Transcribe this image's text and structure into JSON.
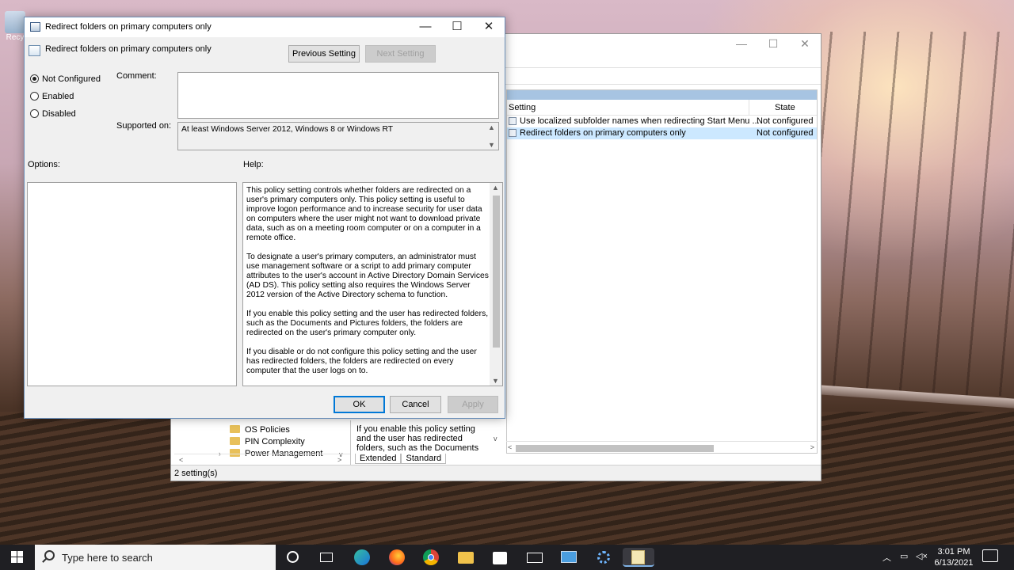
{
  "desktop": {
    "recycle_label": "Recy"
  },
  "background_window": {
    "columns": {
      "setting": "Setting",
      "state": "State"
    },
    "rows": [
      {
        "name": "Use localized subfolder names when redirecting Start Menu ...",
        "state": "Not configured"
      },
      {
        "name": "Redirect folders on primary computers only",
        "state": "Not configured"
      }
    ],
    "tree_items": [
      "OS Policies",
      "PIN Complexity",
      "Power Management"
    ],
    "description_text": "If you enable this policy setting and the user has redirected folders, such as the Documents",
    "tabs": [
      "Extended",
      "Standard"
    ],
    "status": "2 setting(s)"
  },
  "dialog": {
    "title": "Redirect folders on primary computers only",
    "header_title": "Redirect folders on primary computers only",
    "previous_label": "Previous Setting",
    "next_label": "Next Setting",
    "radios": [
      {
        "label": "Not Configured",
        "checked": true
      },
      {
        "label": "Enabled",
        "checked": false
      },
      {
        "label": "Disabled",
        "checked": false
      }
    ],
    "comment_label": "Comment:",
    "comment_value": "",
    "supported_label": "Supported on:",
    "supported_value": "At least Windows Server 2012, Windows 8 or Windows RT",
    "options_label": "Options:",
    "help_label": "Help:",
    "help_paragraphs": [
      "This policy setting controls whether folders are redirected on a user's primary computers only. This policy setting is useful to improve logon performance and to increase security for user data on computers where the user might not want to download private data, such as on a meeting room computer or on a computer in a remote office.",
      "To designate a user's primary computers, an administrator must use management software or a script to add primary computer attributes to the user's account in Active Directory Domain Services (AD DS). This policy setting also requires the Windows Server 2012 version of the Active Directory schema to function.",
      "If you enable this policy setting and the user has redirected folders, such as the Documents and Pictures folders, the folders are redirected on the user's primary computer only.",
      "If you disable or do not configure this policy setting and the user has redirected folders, the folders are redirected on every computer that the user logs on to."
    ],
    "ok_label": "OK",
    "cancel_label": "Cancel",
    "apply_label": "Apply"
  },
  "taskbar": {
    "search_placeholder": "Type here to search",
    "time": "3:01 PM",
    "date": "6/13/2021"
  }
}
